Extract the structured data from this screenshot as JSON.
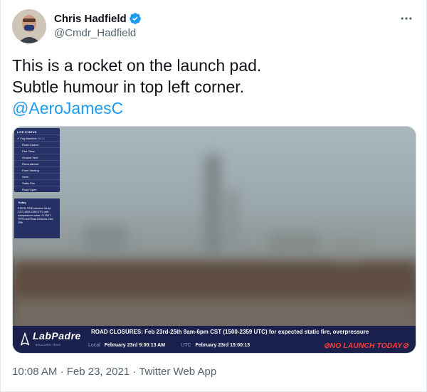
{
  "author": {
    "display_name": "Chris Hadfield",
    "handle": "@Cmdr_Hadfield",
    "verified": true
  },
  "tweet": {
    "text_line1": "This is a rocket on the launch pad.",
    "text_line2": "Subtle humour in top left corner.",
    "mention": "@AeroJamesC"
  },
  "media": {
    "overlay": {
      "status_title": "LIVE STATUS",
      "status_items": [
        "Fog Machine",
        "Road Closed",
        "Pad Clear",
        "Ground Vent",
        "Recondenser",
        "Farm Venting",
        "Siren",
        "Static Fire",
        "Road Open"
      ],
      "checked_item_index": 0,
      "checked_item_time": "08:12",
      "today_title": "Today",
      "today_text": "STATIC FIRE between 9a-6p CST (1500-2359 UTC) with overpressure notice. FLIGHT TFR's and Road Closures 23rd-25th.",
      "logo_name": "LabPadre",
      "logo_sub": "BOCA CHICA, TEXAS",
      "ticker": "ROAD CLOSURES: Feb 23rd-25th 9am-6pm CST (1500-2359 UTC) for expected static fire, overpressure",
      "local_label": "Local",
      "local_value": "February 23rd  9:00:13  AM",
      "utc_label": "UTC",
      "utc_value": "February 23rd  15:00:13",
      "no_launch": "NO LAUNCH TODAY"
    }
  },
  "meta": {
    "time": "10:08 AM",
    "date": "Feb 23, 2021",
    "separator": "·",
    "source": "Twitter Web App"
  },
  "colors": {
    "link": "#1d9bf0",
    "verified": "#1d9bf0",
    "muted": "#536471"
  },
  "icons": [
    "verified-badge-icon",
    "more-options-icon",
    "labpadre-logo-icon",
    "no-entry-icon",
    "checkmark-icon"
  ]
}
